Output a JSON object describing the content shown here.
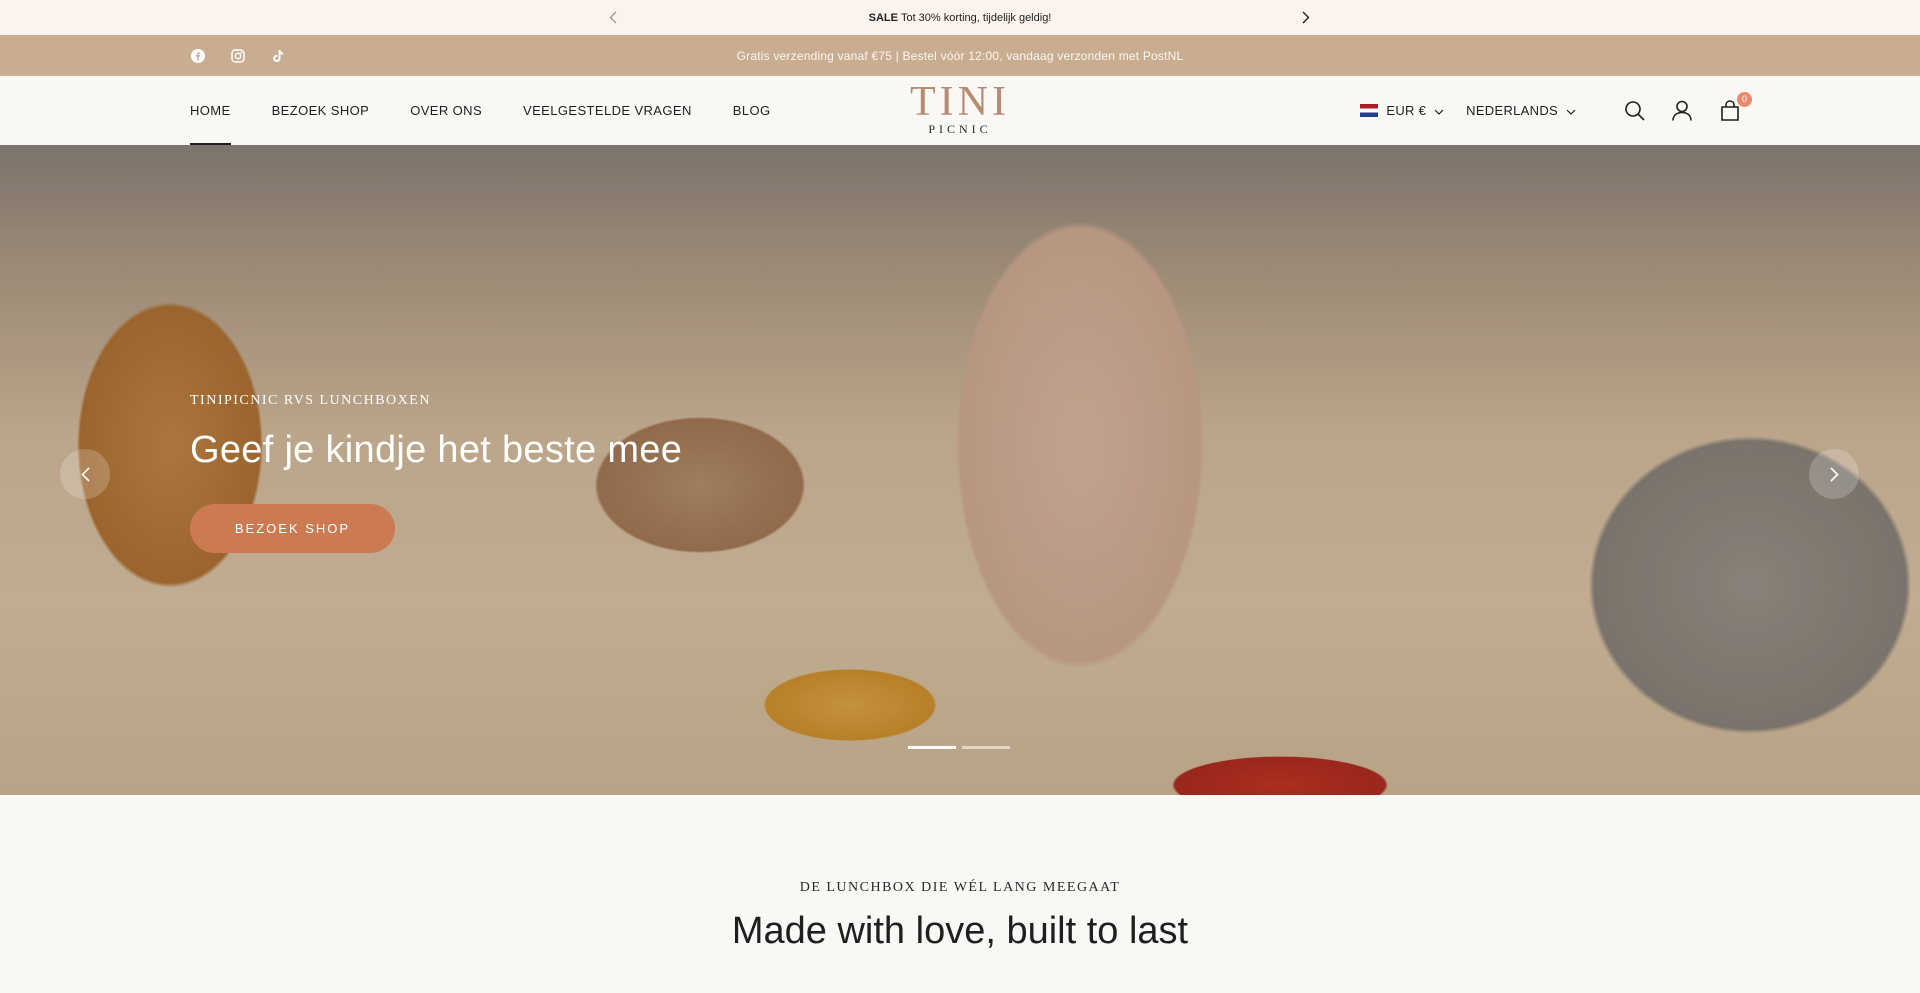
{
  "announcement": {
    "bold": "SALE",
    "text": "Tot 30% korting, tijdelijk geldig!"
  },
  "infobar": {
    "message": "Gratis verzending vanaf €75 | Bestel vóór 12:00, vandaag verzonden met PostNL",
    "social": [
      "facebook-icon",
      "instagram-icon",
      "tiktok-icon"
    ]
  },
  "header": {
    "nav": [
      {
        "label": "HOME",
        "active": true
      },
      {
        "label": "BEZOEK SHOP"
      },
      {
        "label": "OVER ONS"
      },
      {
        "label": "VEELGESTELDE VRAGEN"
      },
      {
        "label": "BLOG"
      }
    ],
    "logo": {
      "main": "TINI",
      "sub": "PICNIC"
    },
    "currency": "EUR €",
    "language": "NEDERLANDS",
    "cart_count": "0"
  },
  "hero": {
    "eyebrow": "TINIPICNIC RVS LUNCHBOXEN",
    "title": "Geef je kindje het beste mee",
    "cta": "BEZOEK SHOP",
    "slides_total": 2,
    "active_slide": 1
  },
  "intro": {
    "eyebrow": "DE LUNCHBOX DIE WÉL LANG MEEGAAT",
    "title": "Made with love, built to last"
  },
  "colors": {
    "infobar": "#c9ad91",
    "logo": "#b98a72",
    "cta": "#cc7a52",
    "badge": "#e98a6d"
  }
}
